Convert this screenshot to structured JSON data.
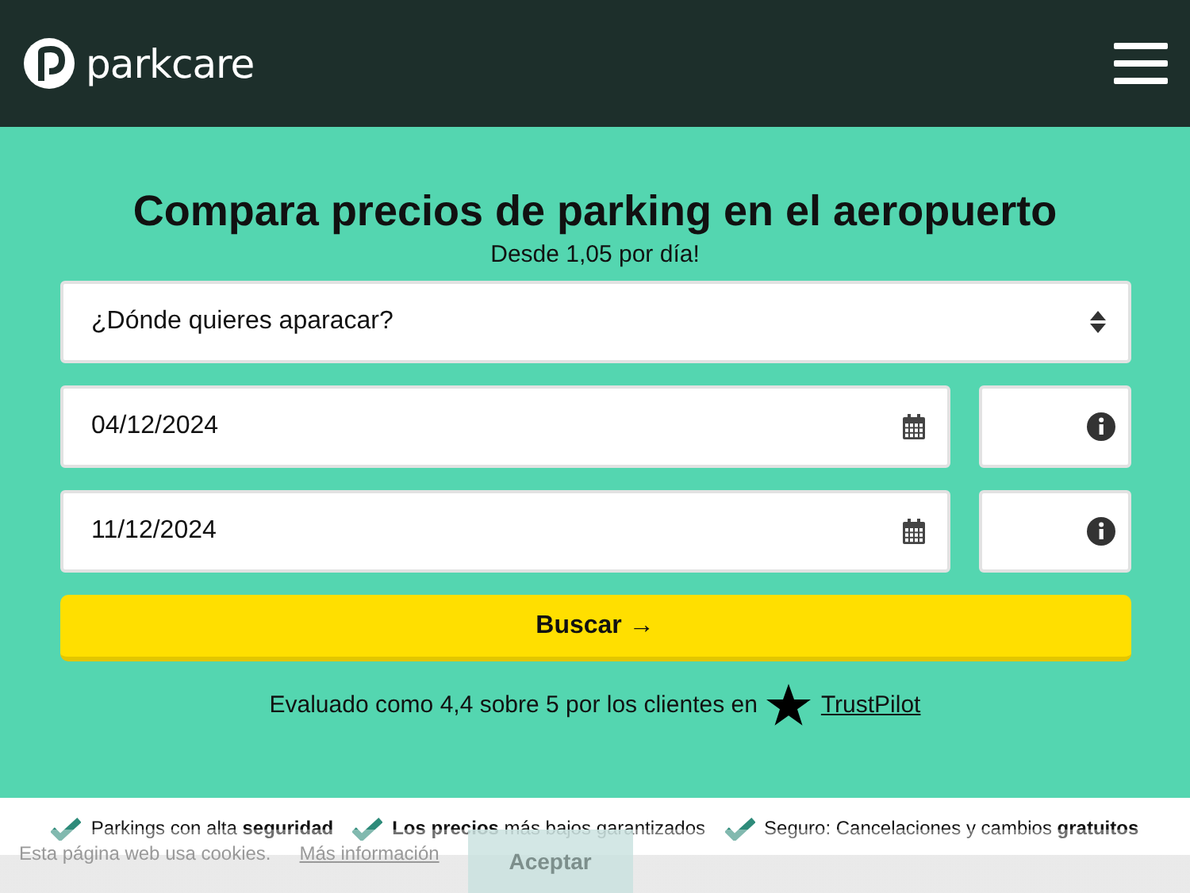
{
  "header": {
    "logo_text": "parkcare"
  },
  "hero": {
    "title": "Compara precios de parking en el aeropuerto",
    "subtitle": "Desde 1,05 por día!"
  },
  "form": {
    "location_placeholder": "¿Dónde quieres aparacar?",
    "date_rows": [
      {
        "date": "04/12/2024"
      },
      {
        "date": "11/12/2024"
      }
    ],
    "search_button": "Buscar",
    "search_arrow": "→"
  },
  "rating": {
    "text": "Evaluado como 4,4 sobre 5 por los clientes en",
    "link": "TrustPilot"
  },
  "features": [
    {
      "text": "Parkings con alta **seguridad**"
    },
    {
      "text": "**Los precios** más bajos garantizados"
    },
    {
      "text": "Seguro: Cancelaciones y cambios **gratuitos**"
    }
  ],
  "cookie_bar": {
    "text": "Esta página web usa cookies.",
    "link": "Más información",
    "button": "Aceptar"
  }
}
